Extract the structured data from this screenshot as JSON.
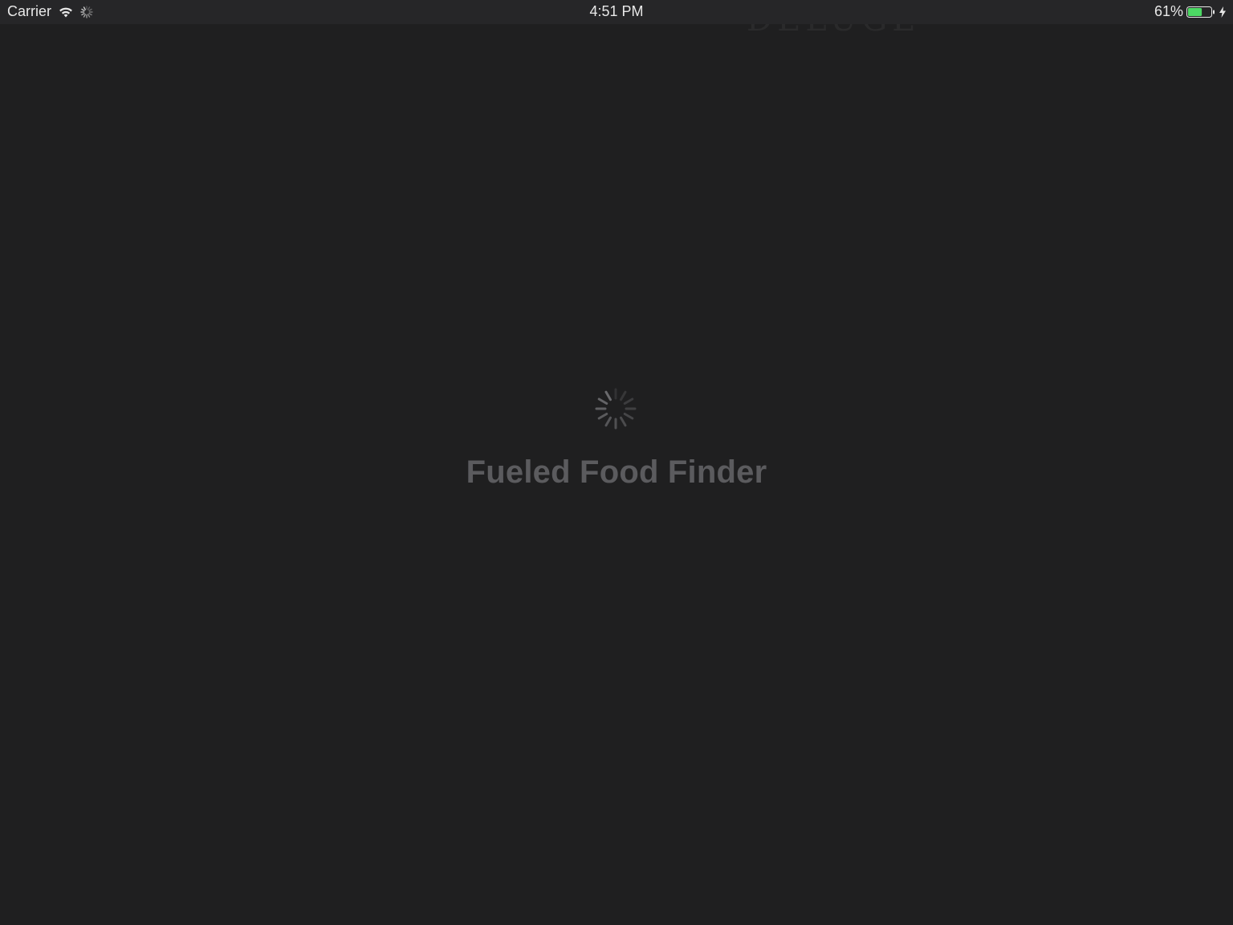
{
  "status_bar": {
    "carrier": "Carrier",
    "time": "4:51 PM",
    "battery_percent": "61%",
    "battery_level": 0.61,
    "battery_color": "#4cd964",
    "icons": [
      "wifi-icon",
      "activity-spinner-icon",
      "battery-icon",
      "charging-bolt-icon"
    ]
  },
  "main": {
    "title": "Fueled Food Finder",
    "loading_indicator": "activity-spinner-icon",
    "title_color": "#5b5b5e",
    "background_color": "#1f1f20"
  }
}
